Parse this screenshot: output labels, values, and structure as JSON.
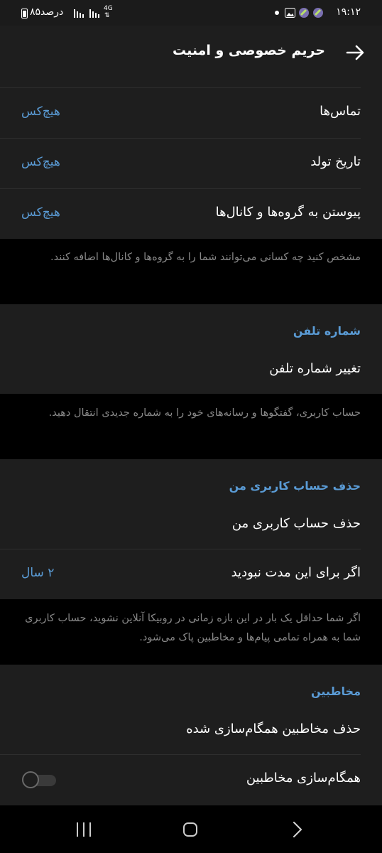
{
  "status_bar": {
    "time": "۱۹:۱۲",
    "battery": "۸۵درصد",
    "network": "4G"
  },
  "header": {
    "title": "حریم خصوصی و امنیت"
  },
  "privacy_rows": [
    {
      "title": "تماس‌ها",
      "value": "هیچ‌کس"
    },
    {
      "title": "تاریخ تولد",
      "value": "هیچ‌کس"
    },
    {
      "title": "پیوستن به گروه‌ها و کانال‌ها",
      "value": "هیچ‌کس"
    }
  ],
  "groups_hint": "مشخص کنید چه کسانی می‌توانند شما را به گروه‌ها و کانال‌ها اضافه کنند.",
  "phone_section": {
    "header": "شماره تلفن",
    "change_label": "تغییر شماره تلفن",
    "hint": "حساب کاربری، گفتگوها و رسانه‌های خود را به شماره جدیدی انتقال دهید."
  },
  "delete_section": {
    "header": "حذف حساب کاربری من",
    "delete_label": "حذف حساب کاربری من",
    "inactive_label": "اگر برای این مدت نبودید",
    "inactive_value": "۲ سال",
    "hint": "اگر شما حداقل یک بار در این بازه زمانی در روبیکا آنلاین نشوید، حساب کاربری شما به همراه تمامی پیام‌ها و مخاطبین پاک می‌شود."
  },
  "contacts_section": {
    "header": "مخاطبین",
    "delete_synced_label": "حذف مخاطبین همگام‌سازی شده",
    "sync_label": "همگام‌سازی مخاطبین",
    "sync_enabled": false
  },
  "colors": {
    "accent": "#5a9bd5",
    "row_bg": "#1e1e1e",
    "page_bg": "#000000",
    "hint_text": "#888888"
  }
}
